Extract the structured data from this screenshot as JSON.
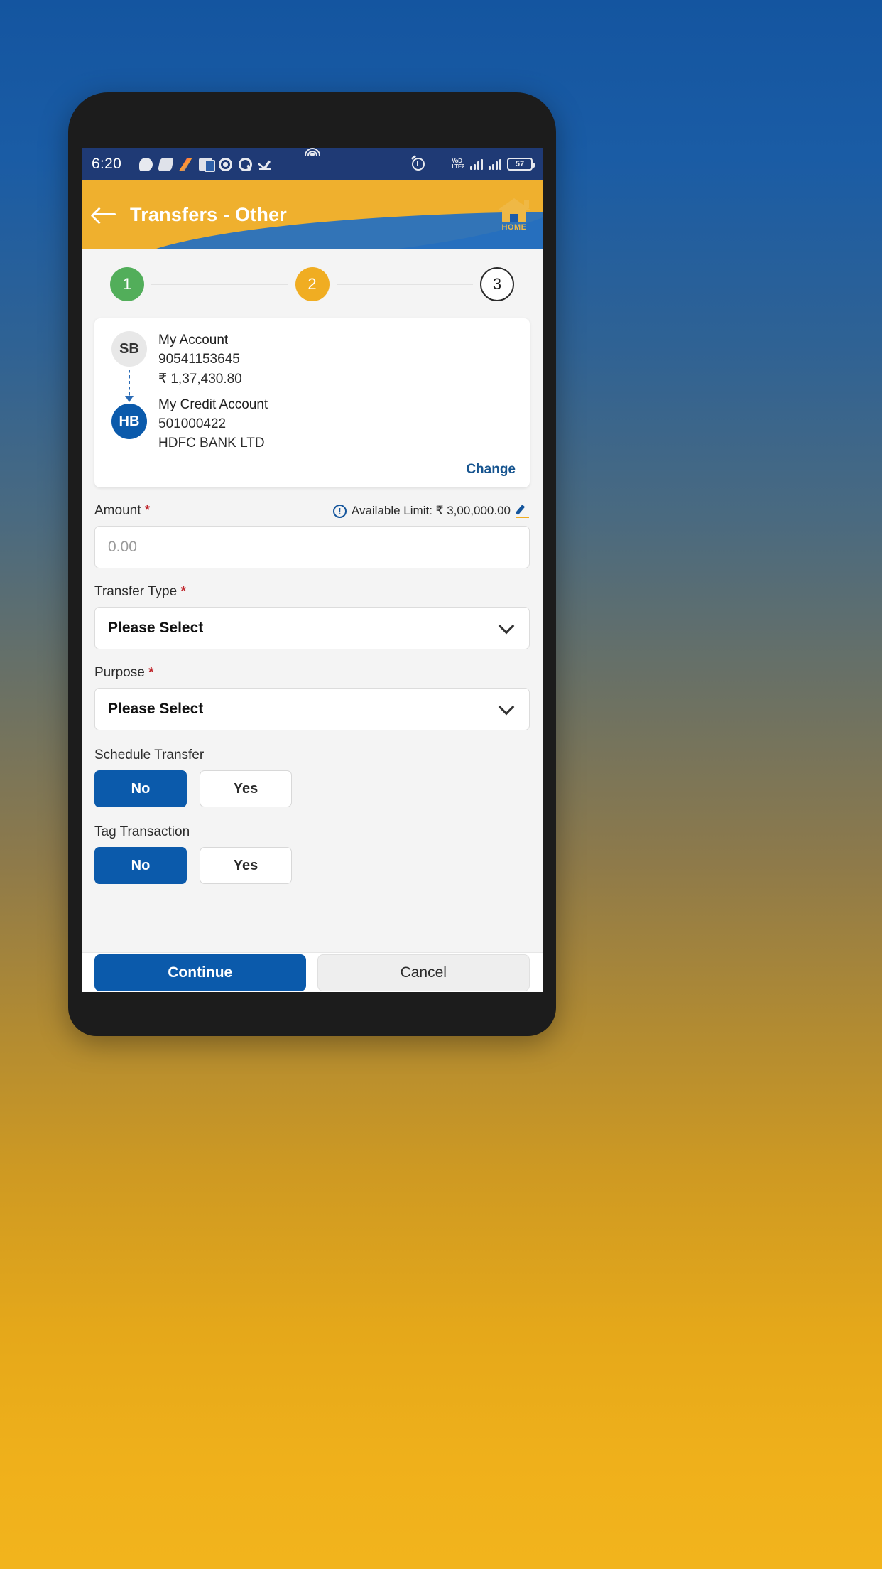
{
  "status_bar": {
    "time": "6:20",
    "left_icons": [
      "chat-icon",
      "slack-icon",
      "gradient-app-icon",
      "outlook-icon",
      "chrome-icon",
      "quora-icon",
      "checkmark-icon"
    ],
    "right_icons": [
      "alarm-icon",
      "wifi-icon"
    ],
    "network_label_top": "VoD",
    "network_label_bottom": "LTE2",
    "battery_level": "57"
  },
  "appbar": {
    "back_icon": "back-arrow-icon",
    "title": "Transfers - Other",
    "home_label": "HOME",
    "amber": "#efb02e",
    "blue": "#1d5ba8"
  },
  "stepper": {
    "steps": [
      {
        "num": "1",
        "state": "done",
        "color": "#52ae5a"
      },
      {
        "num": "2",
        "state": "active",
        "color": "#f0ad22"
      },
      {
        "num": "3",
        "state": "todo",
        "color": "#ffffff"
      }
    ]
  },
  "account_card": {
    "from": {
      "initials": "SB",
      "name": "My Account",
      "number": "90541153645",
      "balance": "₹  1,37,430.80"
    },
    "to": {
      "initials": "HB",
      "name": "My Credit Account",
      "number": "501000422",
      "bank": "HDFC BANK LTD"
    },
    "change_label": "Change"
  },
  "amount_field": {
    "label": "Amount",
    "required_mark": "*",
    "info_icon": "info-icon",
    "limit_text": "Available Limit: ₹ 3,00,000.00",
    "edit_icon": "pencil-edit-icon",
    "placeholder": "0.00",
    "value": ""
  },
  "transfer_type": {
    "label": "Transfer Type",
    "required_mark": "*",
    "selected": "Please Select",
    "chevron": "chevron-down-icon"
  },
  "purpose": {
    "label": "Purpose",
    "required_mark": "*",
    "selected": "Please Select",
    "chevron": "chevron-down-icon"
  },
  "schedule_transfer": {
    "label": "Schedule Transfer",
    "selected": "No",
    "options": [
      "No",
      "Yes"
    ]
  },
  "tag_transaction": {
    "label": "Tag Transaction",
    "selected": "No",
    "options": [
      "No",
      "Yes"
    ]
  },
  "footer": {
    "continue_label": "Continue",
    "cancel_label": "Cancel",
    "primary_color": "#0b5aab"
  },
  "navbar": {
    "items": [
      "menu-icon",
      "home-square-icon",
      "back-triangle-icon"
    ]
  }
}
